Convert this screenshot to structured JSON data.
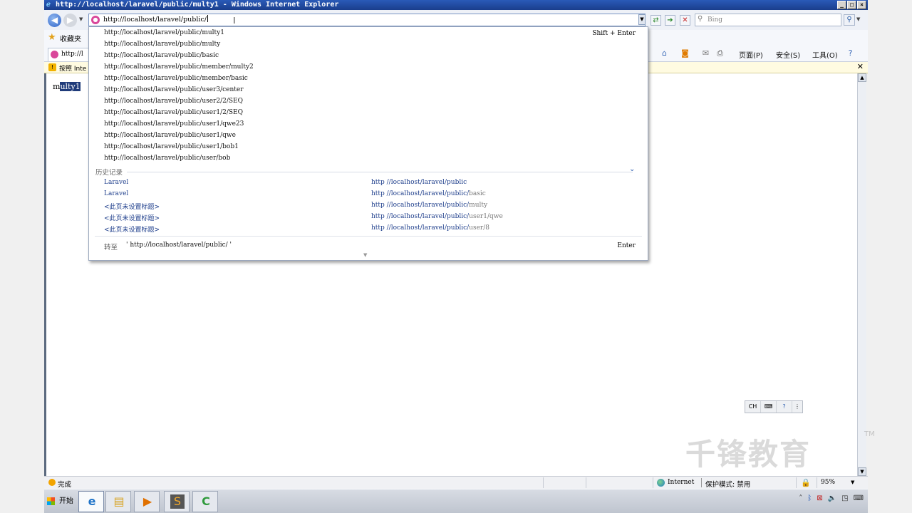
{
  "window": {
    "title": "http://localhost/laravel/public/multy1 - Windows Internet Explorer",
    "minimize_glyph": "_",
    "maximize_glyph": "□",
    "close_glyph": "×"
  },
  "navigation": {
    "address_value": "http://localhost/laravel/public/",
    "search_placeholder": "Bing"
  },
  "favorites_bar": {
    "label": "收藏夹"
  },
  "tab": {
    "label": "http://l"
  },
  "command_bar": {
    "page_menu": "页面(P)",
    "safety_menu": "安全(S)",
    "tools_menu": "工具(O)"
  },
  "info_bar": {
    "text": "按照 Inte"
  },
  "page": {
    "text_unselected": "m",
    "text_selected": "ulty1"
  },
  "autocomplete": {
    "shift_enter_hint": "Shift + Enter",
    "suggestions": [
      "http://localhost/laravel/public/multy1",
      "http://localhost/laravel/public/multy",
      "http://localhost/laravel/public/basic",
      "http://localhost/laravel/public/member/multy2",
      "http://localhost/laravel/public/member/basic",
      "http://localhost/laravel/public/user3/center",
      "http://localhost/laravel/public/user2/2/SEQ",
      "http://localhost/laravel/public/user1/2/SEQ",
      "http://localhost/laravel/public/user1/qwe23",
      "http://localhost/laravel/public/user1/qwe",
      "http://localhost/laravel/public/user1/bob1",
      "http://localhost/laravel/public/user/bob"
    ],
    "history_section_label": "历史记录",
    "history": [
      {
        "title": "Laravel",
        "url_host": "http //localhost/laravel/public",
        "url_rest": ""
      },
      {
        "title": "Laravel",
        "url_host": "http //localhost/laravel/public/",
        "url_rest": "basic"
      },
      {
        "title": "<此页未设置标题>",
        "url_host": "http //localhost/laravel/public/",
        "url_rest": "multy"
      },
      {
        "title": "<此页未设置标题>",
        "url_host": "http //localhost/laravel/public/",
        "url_rest": "user1/qwe"
      },
      {
        "title": "<此页未设置标题>",
        "url_host": "http //localhost/laravel/public/",
        "url_rest": "user/8"
      }
    ],
    "goto_label": "转至",
    "goto_url": "' http://localhost/laravel/public/ '",
    "enter_hint": "Enter"
  },
  "ime_toolbar": {
    "lang": "CH"
  },
  "watermark": {
    "text": "千锋教育",
    "tm": "TM"
  },
  "status_bar": {
    "status_text": "完成",
    "zone": "Internet",
    "protected_mode": "保护模式: 禁用",
    "zoom": "95%"
  },
  "taskbar": {
    "start_label": "开始"
  },
  "colors": {
    "titlebar": "#1a3e8c",
    "selection": "#1f3b7a",
    "history_link": "#1f3f8c"
  }
}
